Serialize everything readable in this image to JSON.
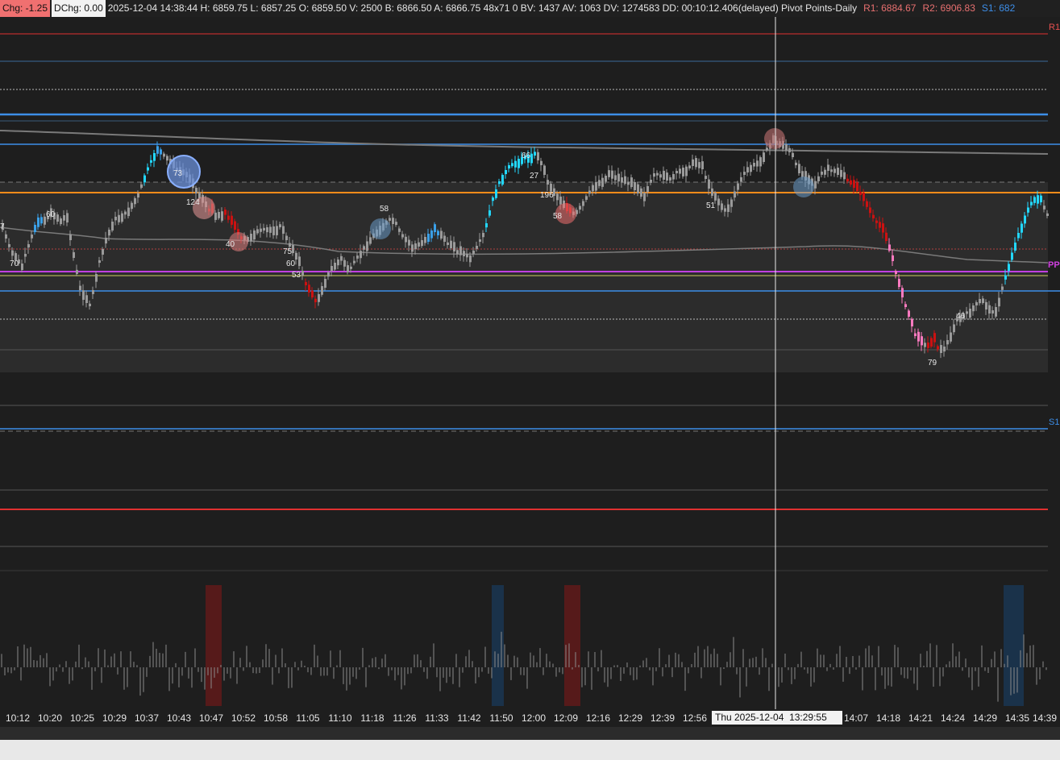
{
  "header": {
    "chg": "Chg: -1.25",
    "dchg": "DChg: 0.00",
    "info": "2025-12-04 14:38:44 H: 6859.75 L: 6857.25 O: 6859.50 V: 2500 B: 6866.50 A: 6866.75 48x71 0 BV: 1437 AV: 1063 DV: 1274583 DD: 00:10:12.406(delayed) Pivot Points-Daily",
    "r1": "R1: 6884.67",
    "r2": "R2: 6906.83",
    "s1": "S1: 682"
  },
  "pivot_labels": {
    "r1": "R1",
    "pp": "PP",
    "s1": "S1"
  },
  "bubble_labels": [
    "7",
    "60",
    "70",
    "73",
    "124",
    "40",
    "75",
    "60",
    "53",
    "58",
    "66",
    "27",
    "196",
    "58",
    "51",
    "79",
    "46"
  ],
  "crosshair_label": "Thu 2025-12-04  13:29:55",
  "x_ticks": [
    "10:12",
    "10:20",
    "10:25",
    "10:29",
    "10:37",
    "10:43",
    "10:47",
    "10:52",
    "10:58",
    "11:05",
    "11:10",
    "11:18",
    "11:26",
    "11:33",
    "11:42",
    "11:50",
    "12:00",
    "12:09",
    "12:16",
    "12:29",
    "12:39",
    "12:56",
    "14:07",
    "14:18",
    "14:21",
    "14:24",
    "14:29",
    "14:35",
    "14:39"
  ],
  "colors": {
    "background": "#1e1e1e",
    "r_line": "#e03030",
    "s_line": "#3d8ee8",
    "orange_line": "#ff8c1a",
    "pp_line": "#c040e0",
    "bull_up": "#22d8ff",
    "bear_down": "#cc1111",
    "pink": "#ff7ac0",
    "gray_candle": "#9a9a9a"
  }
}
